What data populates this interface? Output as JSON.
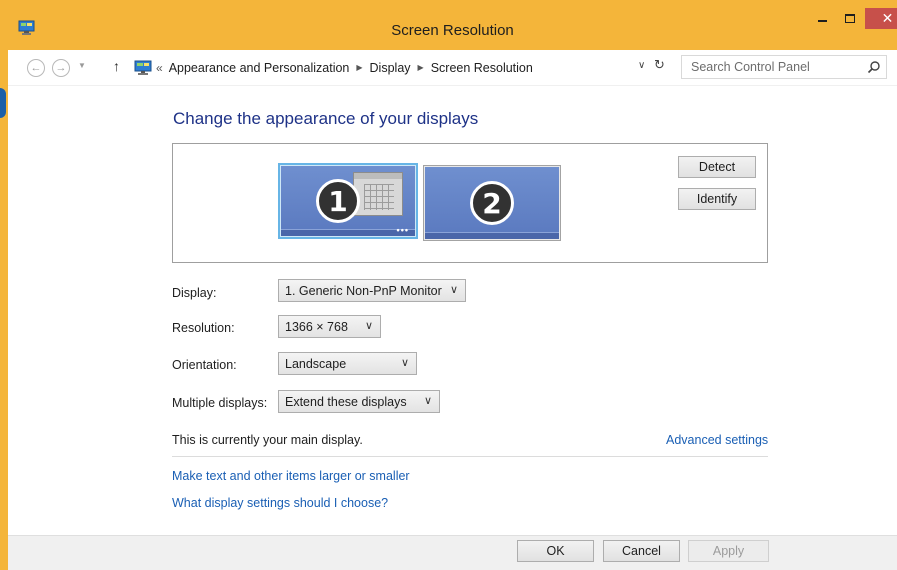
{
  "window": {
    "title": "Screen Resolution",
    "close_glyph": "✕"
  },
  "navigation": {
    "back_glyph": "←",
    "forward_glyph": "→",
    "recent_glyph": "▼",
    "up_glyph": "↑",
    "overflow_glyph": "«",
    "breadcrumbs": [
      "Appearance and Personalization",
      "Display",
      "Screen Resolution"
    ],
    "separator_glyph": "▶",
    "dropdown_glyph": "∨",
    "refresh_glyph": "↻",
    "search_placeholder": "Search Control Panel"
  },
  "main": {
    "heading": "Change the appearance of your displays",
    "monitors": [
      {
        "number": "1",
        "selected": true,
        "dots": "•••"
      },
      {
        "number": "2",
        "selected": false
      }
    ],
    "detect_label": "Detect",
    "identify_label": "Identify",
    "fields": {
      "display": {
        "label": "Display:",
        "value": "1. Generic Non-PnP Monitor"
      },
      "resolution": {
        "label": "Resolution:",
        "value": "1366 × 768"
      },
      "orientation": {
        "label": "Orientation:",
        "value": "Landscape"
      },
      "multiple_displays": {
        "label": "Multiple displays:",
        "value": "Extend these displays"
      }
    },
    "chevron_glyph": "∨",
    "main_display_note": "This is currently your main display.",
    "advanced_settings_link": "Advanced settings",
    "links": [
      "Make text and other items larger or smaller",
      "What display settings should I choose?"
    ]
  },
  "footer": {
    "ok_label": "OK",
    "cancel_label": "Cancel",
    "apply_label": "Apply"
  },
  "colors": {
    "title_bar": "#f4b53a",
    "close_button": "#c7504a",
    "heading": "#1e3287",
    "link": "#1a5fb4",
    "selected_monitor_border": "#67b5e6",
    "monitor_screen": "#6f8fcf"
  },
  "icons": [
    "control-panel-icon",
    "display-icon",
    "search-icon",
    "refresh-icon"
  ]
}
